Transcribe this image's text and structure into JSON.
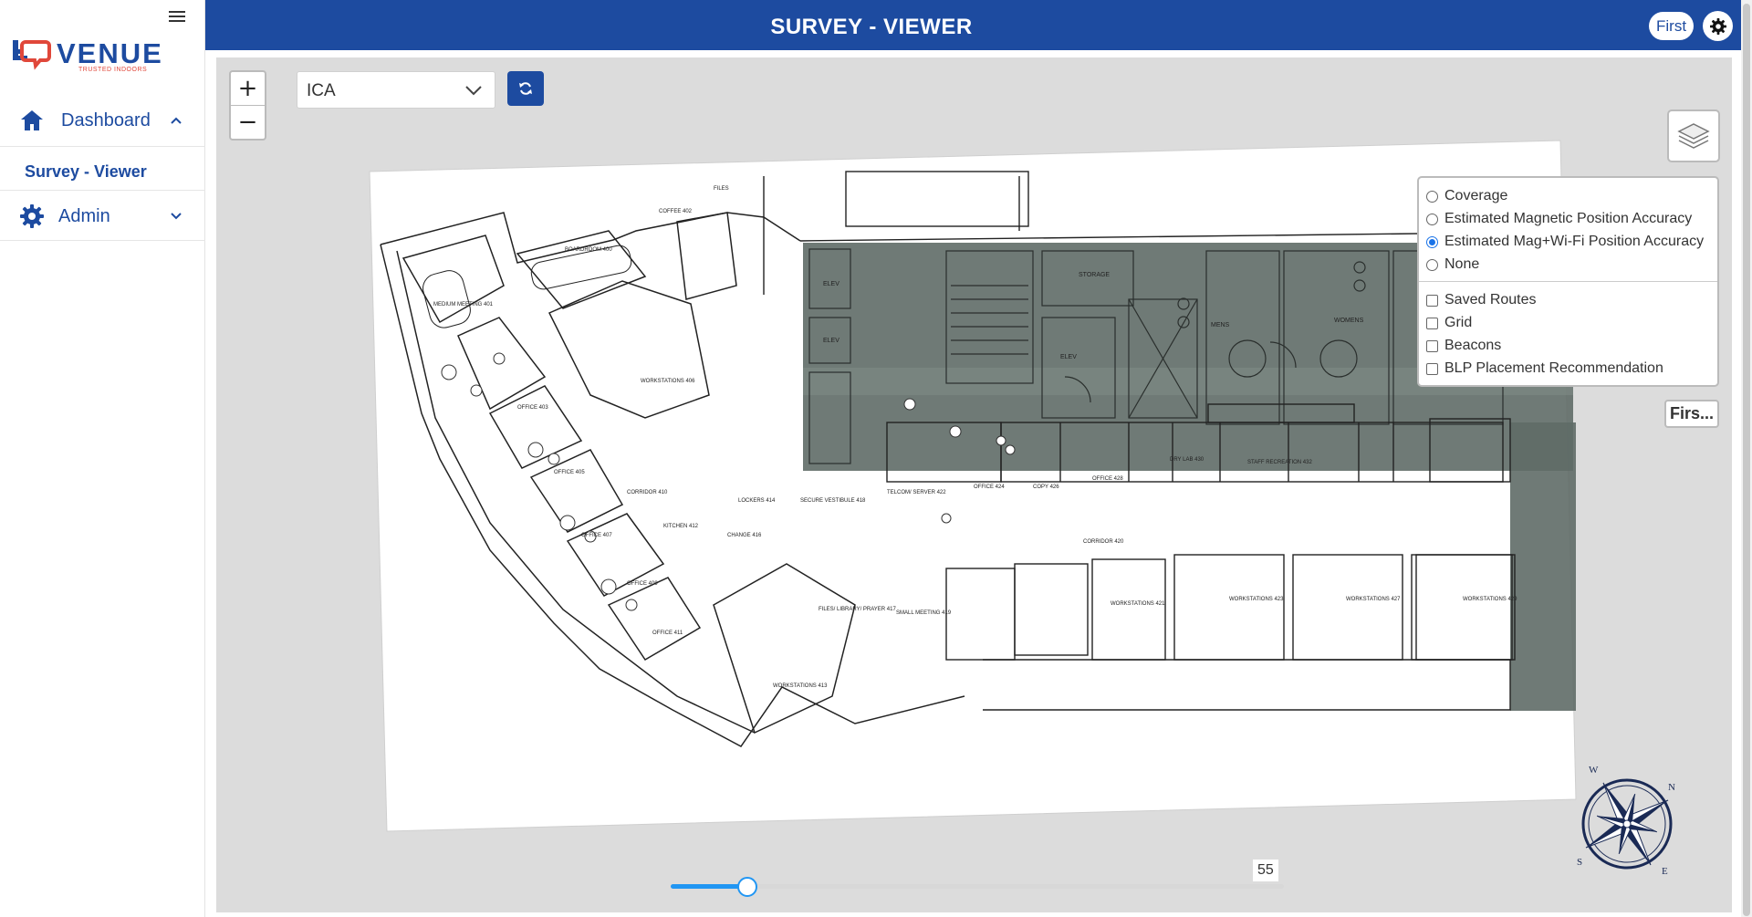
{
  "sidebar": {
    "brand": "VENUE",
    "brand_tagline": "TRUSTED INDOORS",
    "items": [
      {
        "label": "Dashboard",
        "icon": "home-icon",
        "expanded": true
      },
      {
        "label": "Survey - Viewer",
        "selected": true
      },
      {
        "label": "Admin",
        "icon": "gear-icon",
        "expanded": false
      }
    ]
  },
  "header": {
    "title": "SURVEY - VIEWER",
    "user": "First"
  },
  "map": {
    "site_select_value": "ICA",
    "zoom_in": "+",
    "zoom_out": "−",
    "floor_button": "Firs...",
    "layers": {
      "radios": [
        {
          "label": "Coverage",
          "checked": false
        },
        {
          "label": "Estimated Magnetic Position Accuracy",
          "checked": false
        },
        {
          "label": "Estimated Mag+Wi-Fi Position Accuracy",
          "checked": true
        },
        {
          "label": "None",
          "checked": false
        }
      ],
      "checkboxes": [
        {
          "label": "Saved Routes",
          "checked": false
        },
        {
          "label": "Grid",
          "checked": false
        },
        {
          "label": "Beacons",
          "checked": false
        },
        {
          "label": "BLP Placement Recommendation",
          "checked": false
        }
      ]
    },
    "floorplan_labels": {
      "elev1": "ELEV",
      "elev2": "ELEV",
      "elev3": "ELEV",
      "storage": "STORAGE",
      "mens": "MENS",
      "womens": "WOMENS",
      "files": "FILES",
      "coffee": "COFFEE 402",
      "boardroom": "BOARDROOM 400",
      "medium_meeting": "MEDIUM MEETING 401",
      "office403": "OFFICE 403",
      "workstations406": "WORKSTATIONS 406",
      "office405": "OFFICE 405",
      "corridor410": "CORRIDOR 410",
      "office407": "OFFICE 407",
      "kitchen": "KITCHEN 412",
      "office409": "OFFICE 409",
      "office411": "OFFICE 411",
      "workstations413": "WORKSTATIONS 413",
      "lockers": "LOCKERS 414",
      "change": "CHANGE 416",
      "secure_vestibule": "SECURE VESTIBULE 418",
      "telecom": "TELCOM/ SERVER 422",
      "office424": "OFFICE 424",
      "copy": "COPY 426",
      "office428": "OFFICE 428",
      "drylab": "DRY LAB 430",
      "staff_recreation": "STAFF RECREATION 432",
      "corridor420": "CORRIDOR 420",
      "files_library": "FILES/ LIBRARY/ PRAYER 417",
      "small_meeting": "SMALL MEETING 419",
      "ws421": "WORKSTATIONS 421",
      "ws423": "WORKSTATIONS 423",
      "ws427": "WORKSTATIONS 427",
      "ws429": "WORKSTATIONS 429"
    },
    "compass_letters": {
      "n": "N",
      "e": "E",
      "s": "S",
      "w": "W"
    },
    "slider": {
      "value": "55",
      "fraction": 0.125
    }
  },
  "colors": {
    "brand_blue": "#1d4ba0",
    "accent_red": "#e0473a",
    "slider_blue": "#2196f3",
    "core_shade": "#5f6b67"
  }
}
